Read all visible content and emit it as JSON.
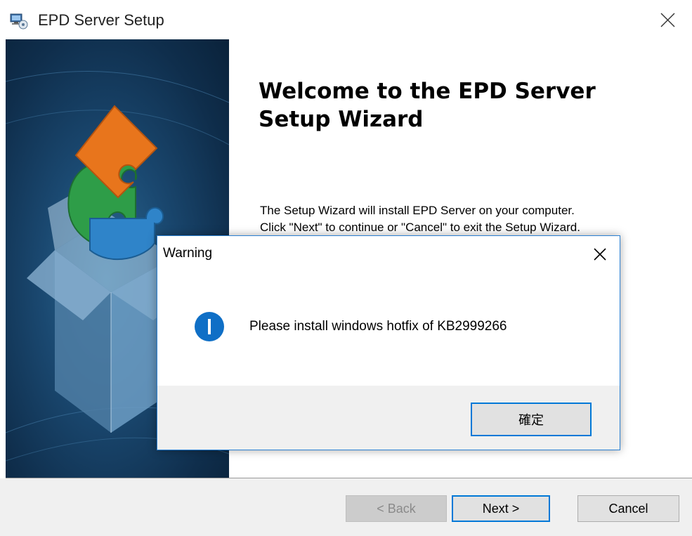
{
  "window": {
    "title": "EPD Server Setup",
    "app_icon": "installer-computer-icon",
    "close_icon": "close-icon"
  },
  "banner": {
    "image": "puzzle-box-illustration"
  },
  "welcome": {
    "title_line1": "Welcome to the EPD Server",
    "title_line2": "Setup Wizard",
    "body_line1": "The Setup Wizard will install EPD Server on your computer.",
    "body_line2": "Click \"Next\" to continue or \"Cancel\" to exit the Setup Wizard."
  },
  "footer": {
    "back_label": "< Back",
    "next_label": "Next >",
    "cancel_label": "Cancel"
  },
  "dialog": {
    "title": "Warning",
    "icon": "info-icon",
    "message": "Please install windows hotfix of KB2999266",
    "ok_label": "確定",
    "accent_color": "#0078d7"
  }
}
